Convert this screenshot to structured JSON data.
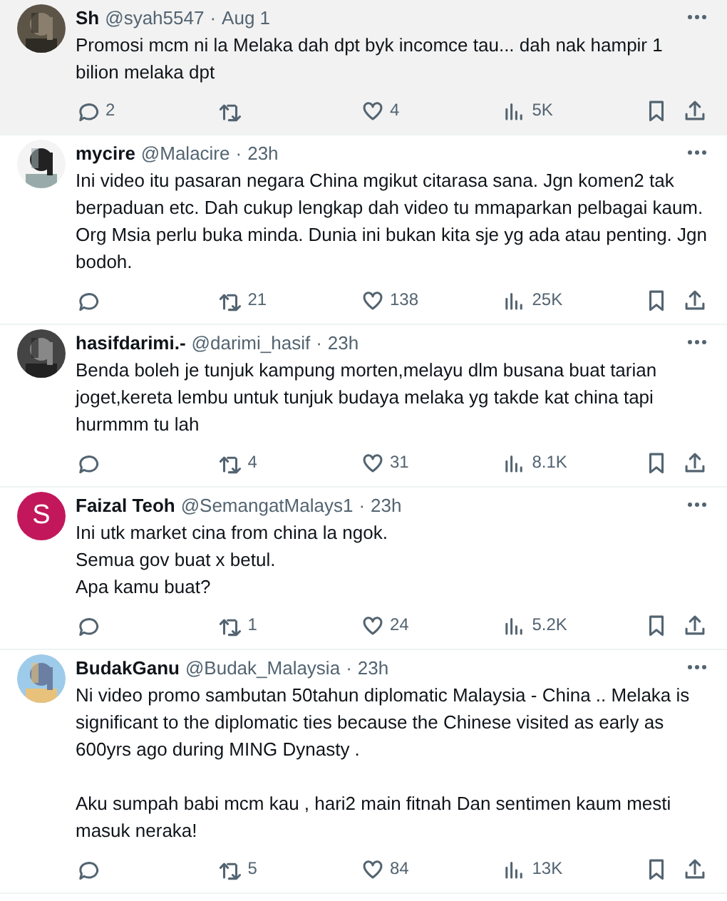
{
  "tweets": [
    {
      "name": "Sh",
      "handle": "@syah5547",
      "separator": "·",
      "time": "Aug 1",
      "highlighted": true,
      "text": "Promosi mcm ni la Melaka dah dpt byk incomce tau... dah nak hampir 1 bilion melaka dpt",
      "replies": "2",
      "likes": "4",
      "views": "5K"
    },
    {
      "name": "mycire",
      "handle": "@Malacire",
      "separator": "·",
      "time": "23h",
      "highlighted": false,
      "text": "Ini video itu pasaran negara China mgikut citarasa sana. Jgn komen2 tak berpaduan etc. Dah cukup lengkap dah video tu mmaparkan pelbagai kaum. Org Msia perlu buka minda. Dunia ini bukan kita sje yg ada atau penting. Jgn bodoh.",
      "retweets": "21",
      "likes": "138",
      "views": "25K"
    },
    {
      "name": "hasifdarimi.-",
      "handle": "@darimi_hasif",
      "separator": "·",
      "time": "23h",
      "highlighted": false,
      "text": "Benda boleh je tunjuk kampung morten,melayu dlm busana buat tarian joget,kereta lembu untuk tunjuk budaya melaka yg takde kat china tapi hurmmm tu lah",
      "retweets": "4",
      "likes": "31",
      "views": "8.1K"
    },
    {
      "name": "Faizal Teoh",
      "handle": "@SemangatMalays1",
      "separator": "·",
      "time": "23h",
      "highlighted": false,
      "avatar": {
        "kind": "letter",
        "letter": "S",
        "color": "#c2185b"
      },
      "text": "Ini utk market cina from china la ngok.\nSemua gov buat x betul.\nApa kamu buat?",
      "retweets": "1",
      "likes": "24",
      "views": "5.2K"
    },
    {
      "name": "BudakGanu",
      "handle": "@Budak_Malaysia",
      "separator": "·",
      "time": "23h",
      "highlighted": false,
      "text": "Ni video promo sambutan 50tahun diplomatic Malaysia - China .. Melaka is significant to the diplomatic ties because the Chinese visited as early as 600yrs ago during MING Dynasty .\n\nAku sumpah babi mcm kau , hari2 main fitnah Dan sentimen kaum mesti masuk neraka!",
      "retweets": "5",
      "likes": "84",
      "views": "13K"
    }
  ]
}
